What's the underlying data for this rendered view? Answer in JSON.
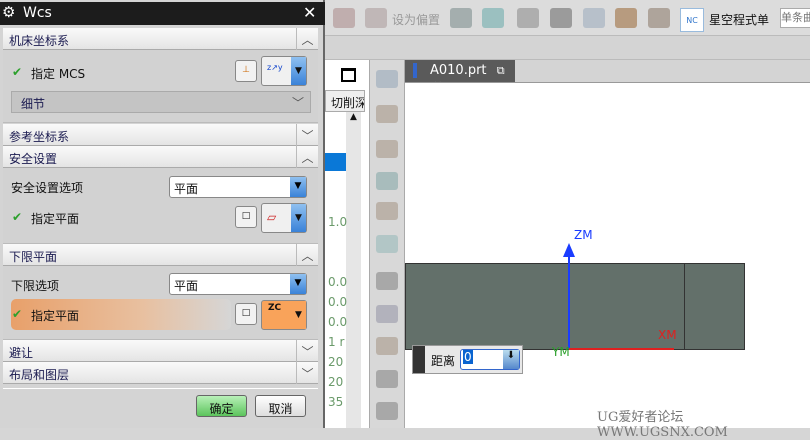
{
  "dialog": {
    "title": "Wcs",
    "close": "✕",
    "sections": {
      "mcs": {
        "title": "机床坐标系",
        "specify": "指定 MCS",
        "details": "细节"
      },
      "ref": {
        "title": "参考坐标系"
      },
      "safety": {
        "title": "安全设置",
        "option_label": "安全设置选项",
        "option_value": "平面",
        "specify": "指定平面"
      },
      "lower": {
        "title": "下限平面",
        "option_label": "下限选项",
        "option_value": "平面",
        "specify": "指定平面",
        "plane_icon_label": "ZC"
      },
      "avoid": {
        "title": "避让"
      },
      "layout": {
        "title": "布局和图层"
      }
    },
    "ok": "确定",
    "cancel": "取消"
  },
  "toolbar": {
    "set_offset": "设为偏置",
    "nc_icon": "NC",
    "program_list": "星空程式单",
    "filter_placeholder": "单条曲"
  },
  "navigator": {
    "column_header": "切削深",
    "values": [
      "1.0",
      "0.0",
      "0.0",
      "0.0",
      "1 r",
      "20",
      "20",
      "35"
    ]
  },
  "viewport": {
    "tab": "A010.prt",
    "axes": {
      "z": "ZM",
      "x": "XM",
      "y": "YM"
    },
    "distance_label": "距离",
    "distance_value": "0",
    "watermark": "UG爱好者论坛 WWW.UGSNX.COM"
  },
  "colors": {
    "title_bg": "#1c1c1c",
    "highlight": "#e8a06a",
    "ok": "#7fd67f",
    "z_axis": "#1a3cff",
    "x_axis": "#e02020",
    "y_axis": "#2ca02c",
    "solid": "#63706a"
  }
}
